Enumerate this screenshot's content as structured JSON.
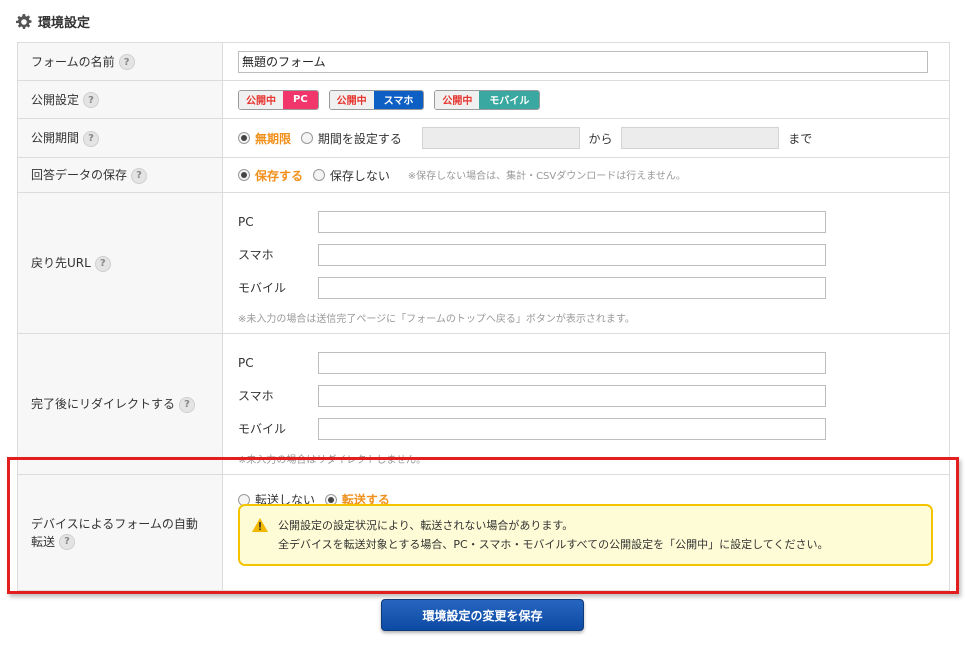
{
  "section": {
    "title": "環境設定",
    "icon": "gear-icon"
  },
  "help_mark": "?",
  "rows": {
    "form_name": {
      "label": "フォームの名前",
      "value": "無題のフォーム"
    },
    "publish": {
      "label": "公開設定",
      "badges": [
        {
          "status": "公開中",
          "device": "PC",
          "color": "#f0366b"
        },
        {
          "status": "公開中",
          "device": "スマホ",
          "color": "#0d5fc4"
        },
        {
          "status": "公開中",
          "device": "モバイル",
          "color": "#39a8a0"
        }
      ]
    },
    "period": {
      "label": "公開期間",
      "opt_unlimited": "無期限",
      "opt_set": "期間を設定する",
      "from": "から",
      "to": "まで"
    },
    "save_data": {
      "label": "回答データの保存",
      "opt_save": "保存する",
      "opt_nosave": "保存しない",
      "note": "※保存しない場合は、集計・CSVダウンロードは行えません。"
    },
    "return_url": {
      "label": "戻り先URL",
      "pc": "PC",
      "sp": "スマホ",
      "mobile": "モバイル",
      "note": "※未入力の場合は送信完了ページに「フォームのトップへ戻る」ボタンが表示されます。"
    },
    "redirect": {
      "label": "完了後にリダイレクトする",
      "pc": "PC",
      "sp": "スマホ",
      "mobile": "モバイル",
      "note": "※未入力の場合はリダイレクトしません。"
    },
    "device_redirect": {
      "label": "デバイスによるフォームの自動転送",
      "opt_no": "転送しない",
      "opt_yes": "転送する",
      "warning_line1": "公開設定の設定状況により、転送されない場合があります。",
      "warning_line2": "全デバイスを転送対象とする場合、PC・スマホ・モバイルすべての公開設定を「公開中」に設定してください。"
    }
  },
  "save_button": "環境設定の変更を保存"
}
